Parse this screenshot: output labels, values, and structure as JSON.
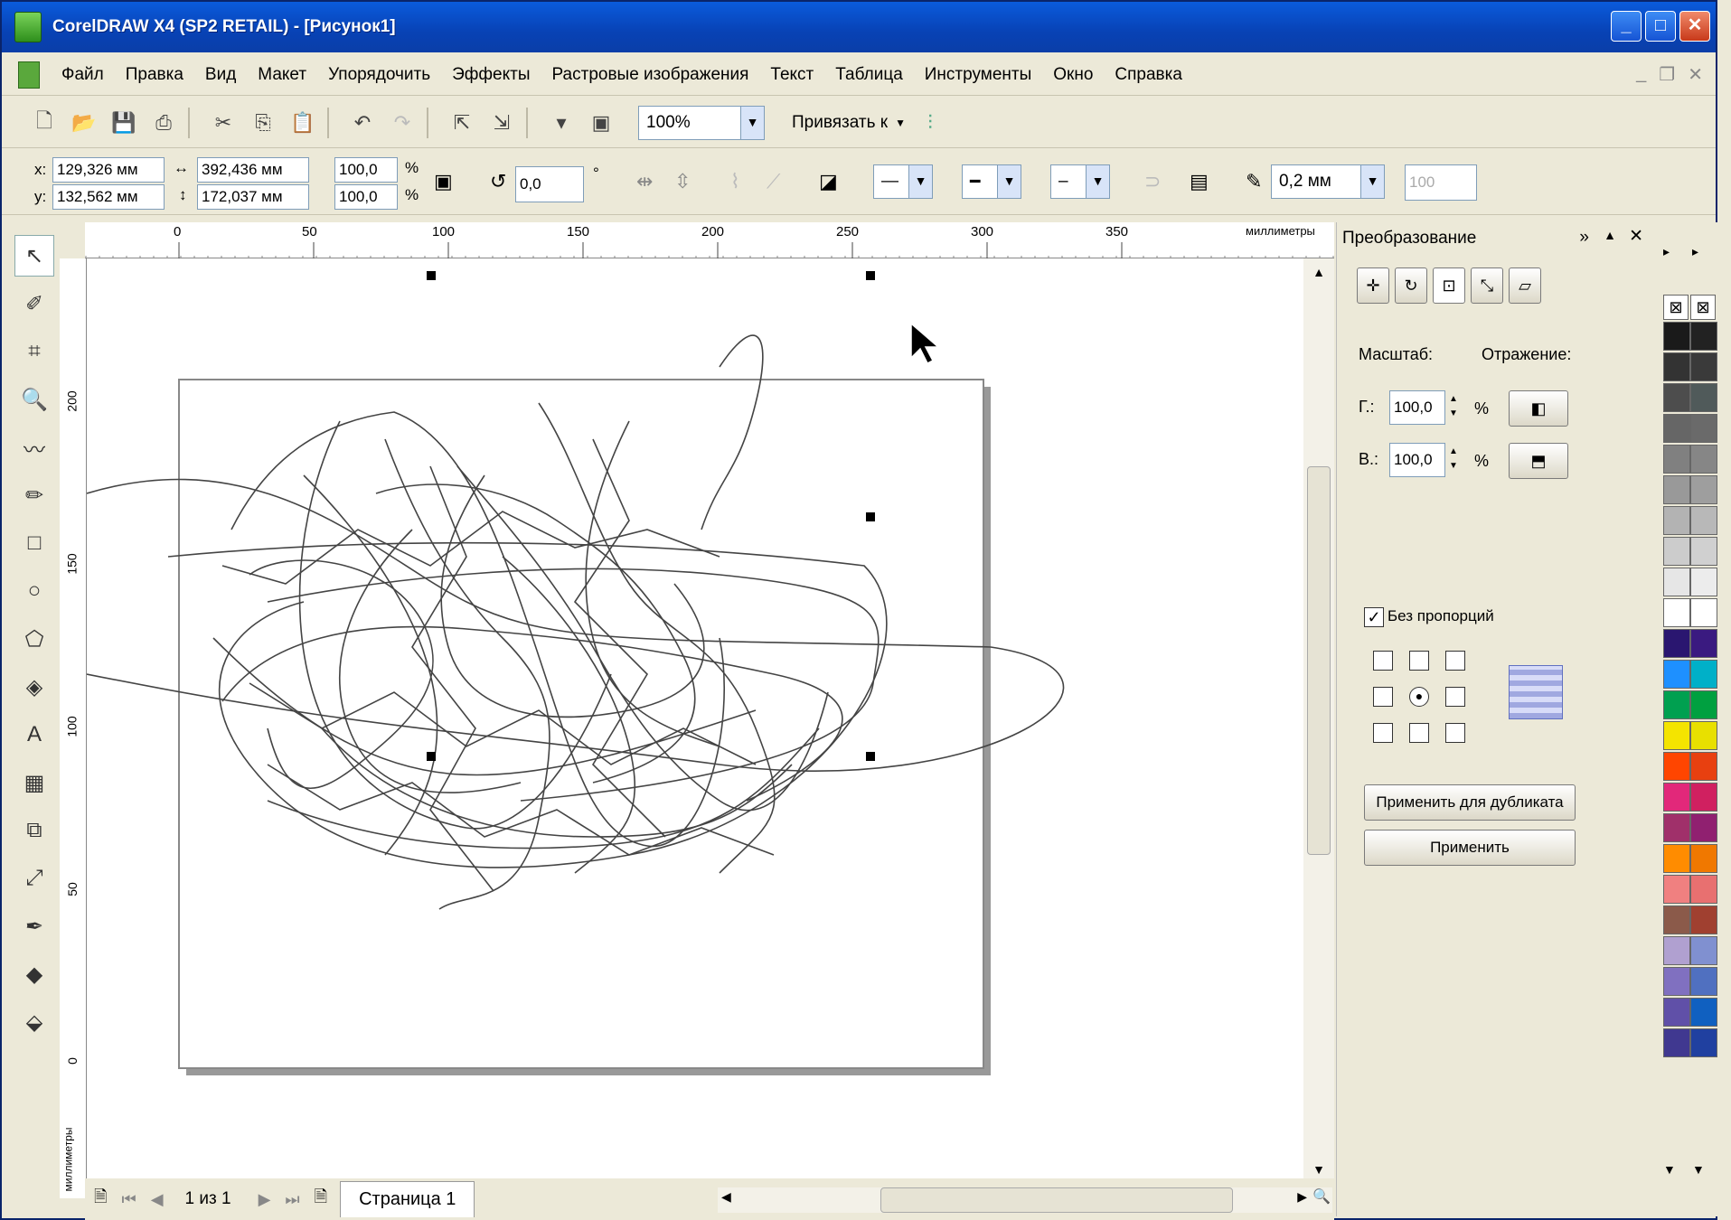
{
  "window": {
    "title": "CorelDRAW X4 (SP2 RETAIL) - [Рисунок1]"
  },
  "menu": [
    "Файл",
    "Правка",
    "Вид",
    "Макет",
    "Упорядочить",
    "Эффекты",
    "Растровые изображения",
    "Текст",
    "Таблица",
    "Инструменты",
    "Окно",
    "Справка"
  ],
  "toolbar": {
    "zoom": "100%",
    "snap_label": "Привязать к"
  },
  "property_bar": {
    "x": "129,326 мм",
    "y": "132,562 мм",
    "width": "392,436 мм",
    "height": "172,037 мм",
    "scale_x": "100,0",
    "scale_y": "100,0",
    "percent": "%",
    "rotation": "0,0",
    "degree": "°",
    "outline_width": "0,2 мм",
    "transparency": "100"
  },
  "ruler": {
    "h_ticks": [
      "0",
      "50",
      "100",
      "150",
      "200",
      "250",
      "300",
      "350"
    ],
    "h_unit": "миллиметры",
    "v_ticks": [
      "200",
      "150",
      "100",
      "50",
      "0"
    ],
    "v_unit": "миллиметры"
  },
  "status": {
    "page_count": "1 из 1",
    "page_tab": "Страница 1"
  },
  "docker": {
    "title": "Преобразование",
    "scale_label": "Масштаб:",
    "mirror_label": "Отражение:",
    "h_label": "Г.:",
    "v_label": "В.:",
    "h_value": "100,0",
    "v_value": "100,0",
    "percent": "%",
    "nonprop_label": "Без пропорций",
    "apply_dup": "Применить для дубликата",
    "apply": "Применить"
  },
  "palette_colors": {
    "col1": [
      "#1a1a1a",
      "#333333",
      "#4d4d4d",
      "#666666",
      "#808080",
      "#999999",
      "#b3b3b3",
      "#cccccc",
      "#e6e6e6",
      "#ffffff",
      "#2a1670",
      "#1e90ff",
      "#00a050",
      "#f4e400",
      "#ff4500",
      "#e2287a",
      "#a0306a",
      "#ff8c00",
      "#f08080",
      "#8b5a4a",
      "#b0a0d0",
      "#8070c0",
      "#6050a8",
      "#403890"
    ],
    "col2": [
      "#222222",
      "#3a3a3a",
      "#505a5a",
      "#6a6a6a",
      "#868686",
      "#9e9e9e",
      "#b8b8b8",
      "#d0d0d0",
      "#ececec",
      "#ffffff",
      "#3a1a80",
      "#00b0c8",
      "#00a040",
      "#e8e000",
      "#e84010",
      "#d02060",
      "#902070",
      "#f07800",
      "#e87070",
      "#a04030",
      "#8090d0",
      "#5070c0",
      "#1060c0",
      "#2040a0"
    ]
  }
}
